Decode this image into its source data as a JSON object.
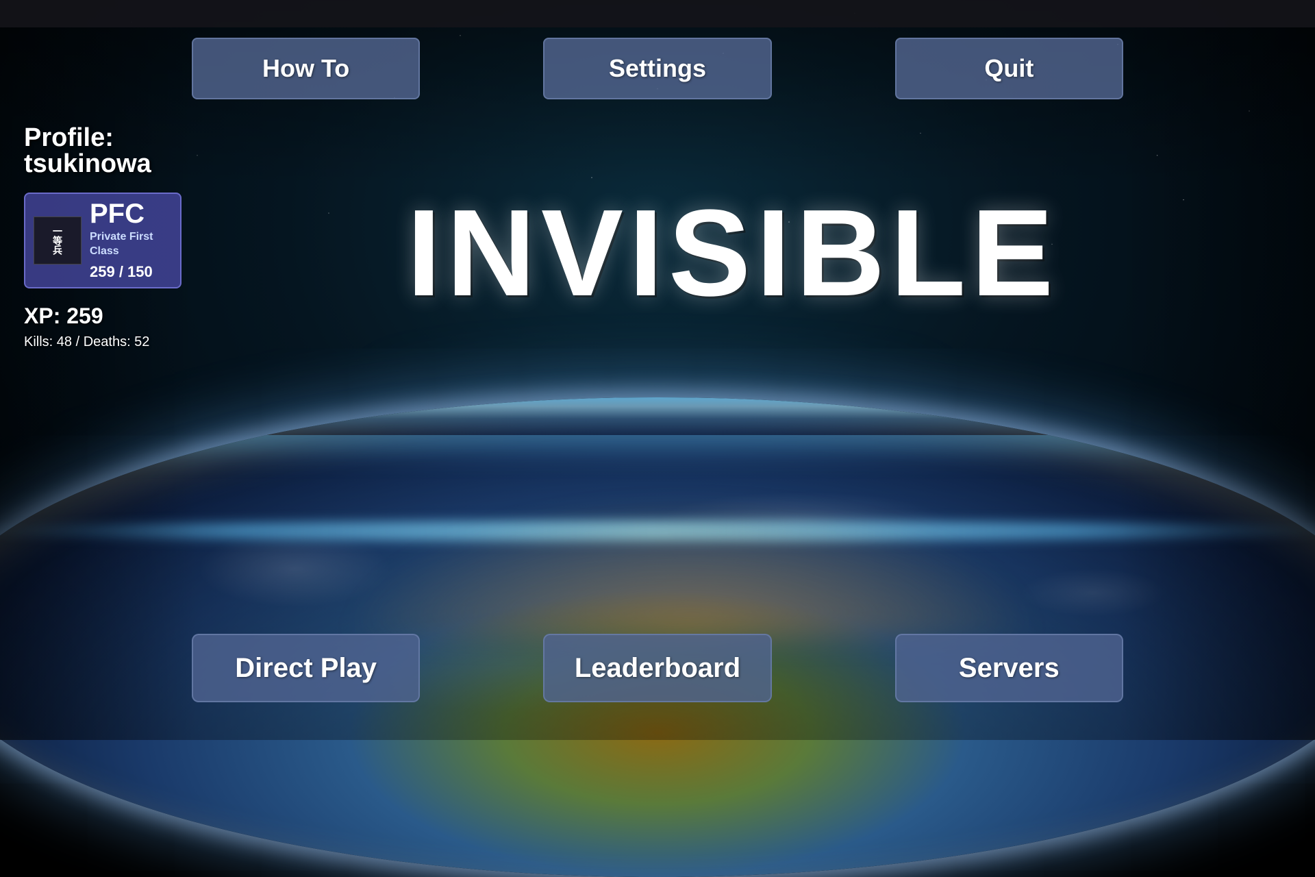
{
  "topbar": {
    "visible": true
  },
  "topNav": {
    "buttons": [
      {
        "id": "howto",
        "label": "How To"
      },
      {
        "id": "settings",
        "label": "Settings"
      },
      {
        "id": "quit",
        "label": "Quit"
      }
    ]
  },
  "profile": {
    "label": "Profile:",
    "username": "tsukinowa",
    "rank_abbr": "PFC",
    "rank_full_line1": "Private First",
    "rank_full_line2": "Class",
    "rank_xp": "259 / 150",
    "rank_emblem_text": "一等兵",
    "xp_label": "XP: 259",
    "kills_deaths_label": "Kills: 48 / Deaths: 52"
  },
  "gameTitle": {
    "text": "INVISIBLE"
  },
  "bottomNav": {
    "buttons": [
      {
        "id": "directplay",
        "label": "Direct Play"
      },
      {
        "id": "leaderboard",
        "label": "Leaderboard"
      },
      {
        "id": "servers",
        "label": "Servers"
      }
    ]
  }
}
